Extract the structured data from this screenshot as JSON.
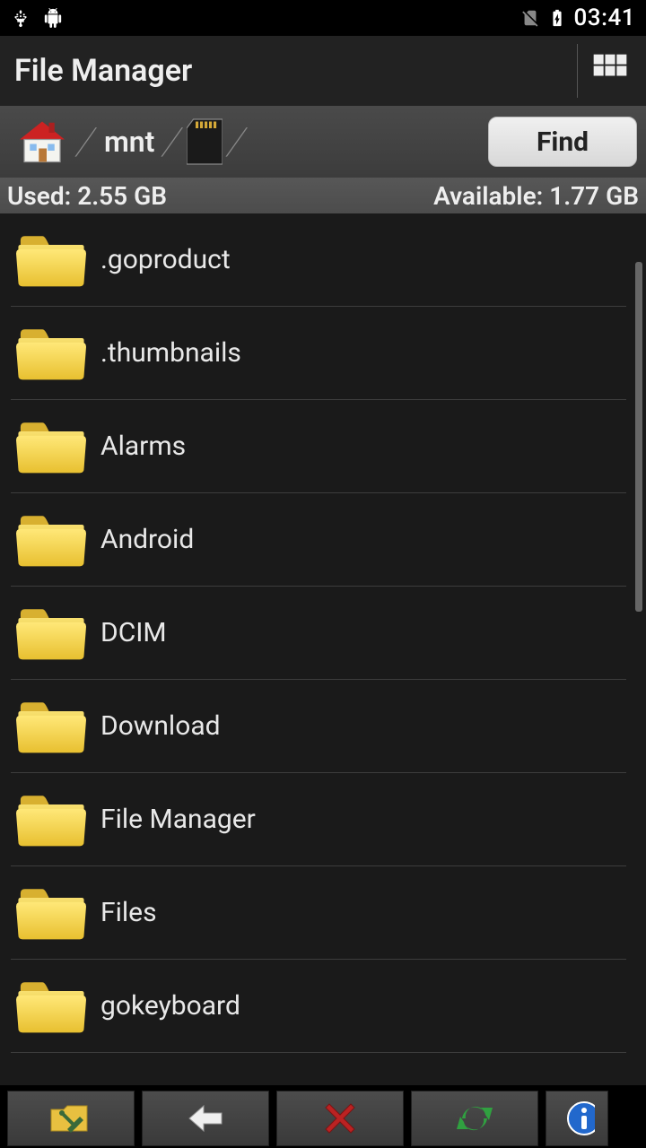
{
  "status": {
    "clock": "03:41"
  },
  "app": {
    "title": "File Manager"
  },
  "path": {
    "seg1": "mnt",
    "find_label": "Find"
  },
  "storage": {
    "used": "Used: 2.55 GB",
    "available": "Available: 1.77 GB"
  },
  "files": [
    {
      "name": ".goproduct"
    },
    {
      "name": ".thumbnails"
    },
    {
      "name": "Alarms"
    },
    {
      "name": "Android"
    },
    {
      "name": "DCIM"
    },
    {
      "name": "Download"
    },
    {
      "name": "File Manager"
    },
    {
      "name": "Files"
    },
    {
      "name": "gokeyboard"
    }
  ]
}
